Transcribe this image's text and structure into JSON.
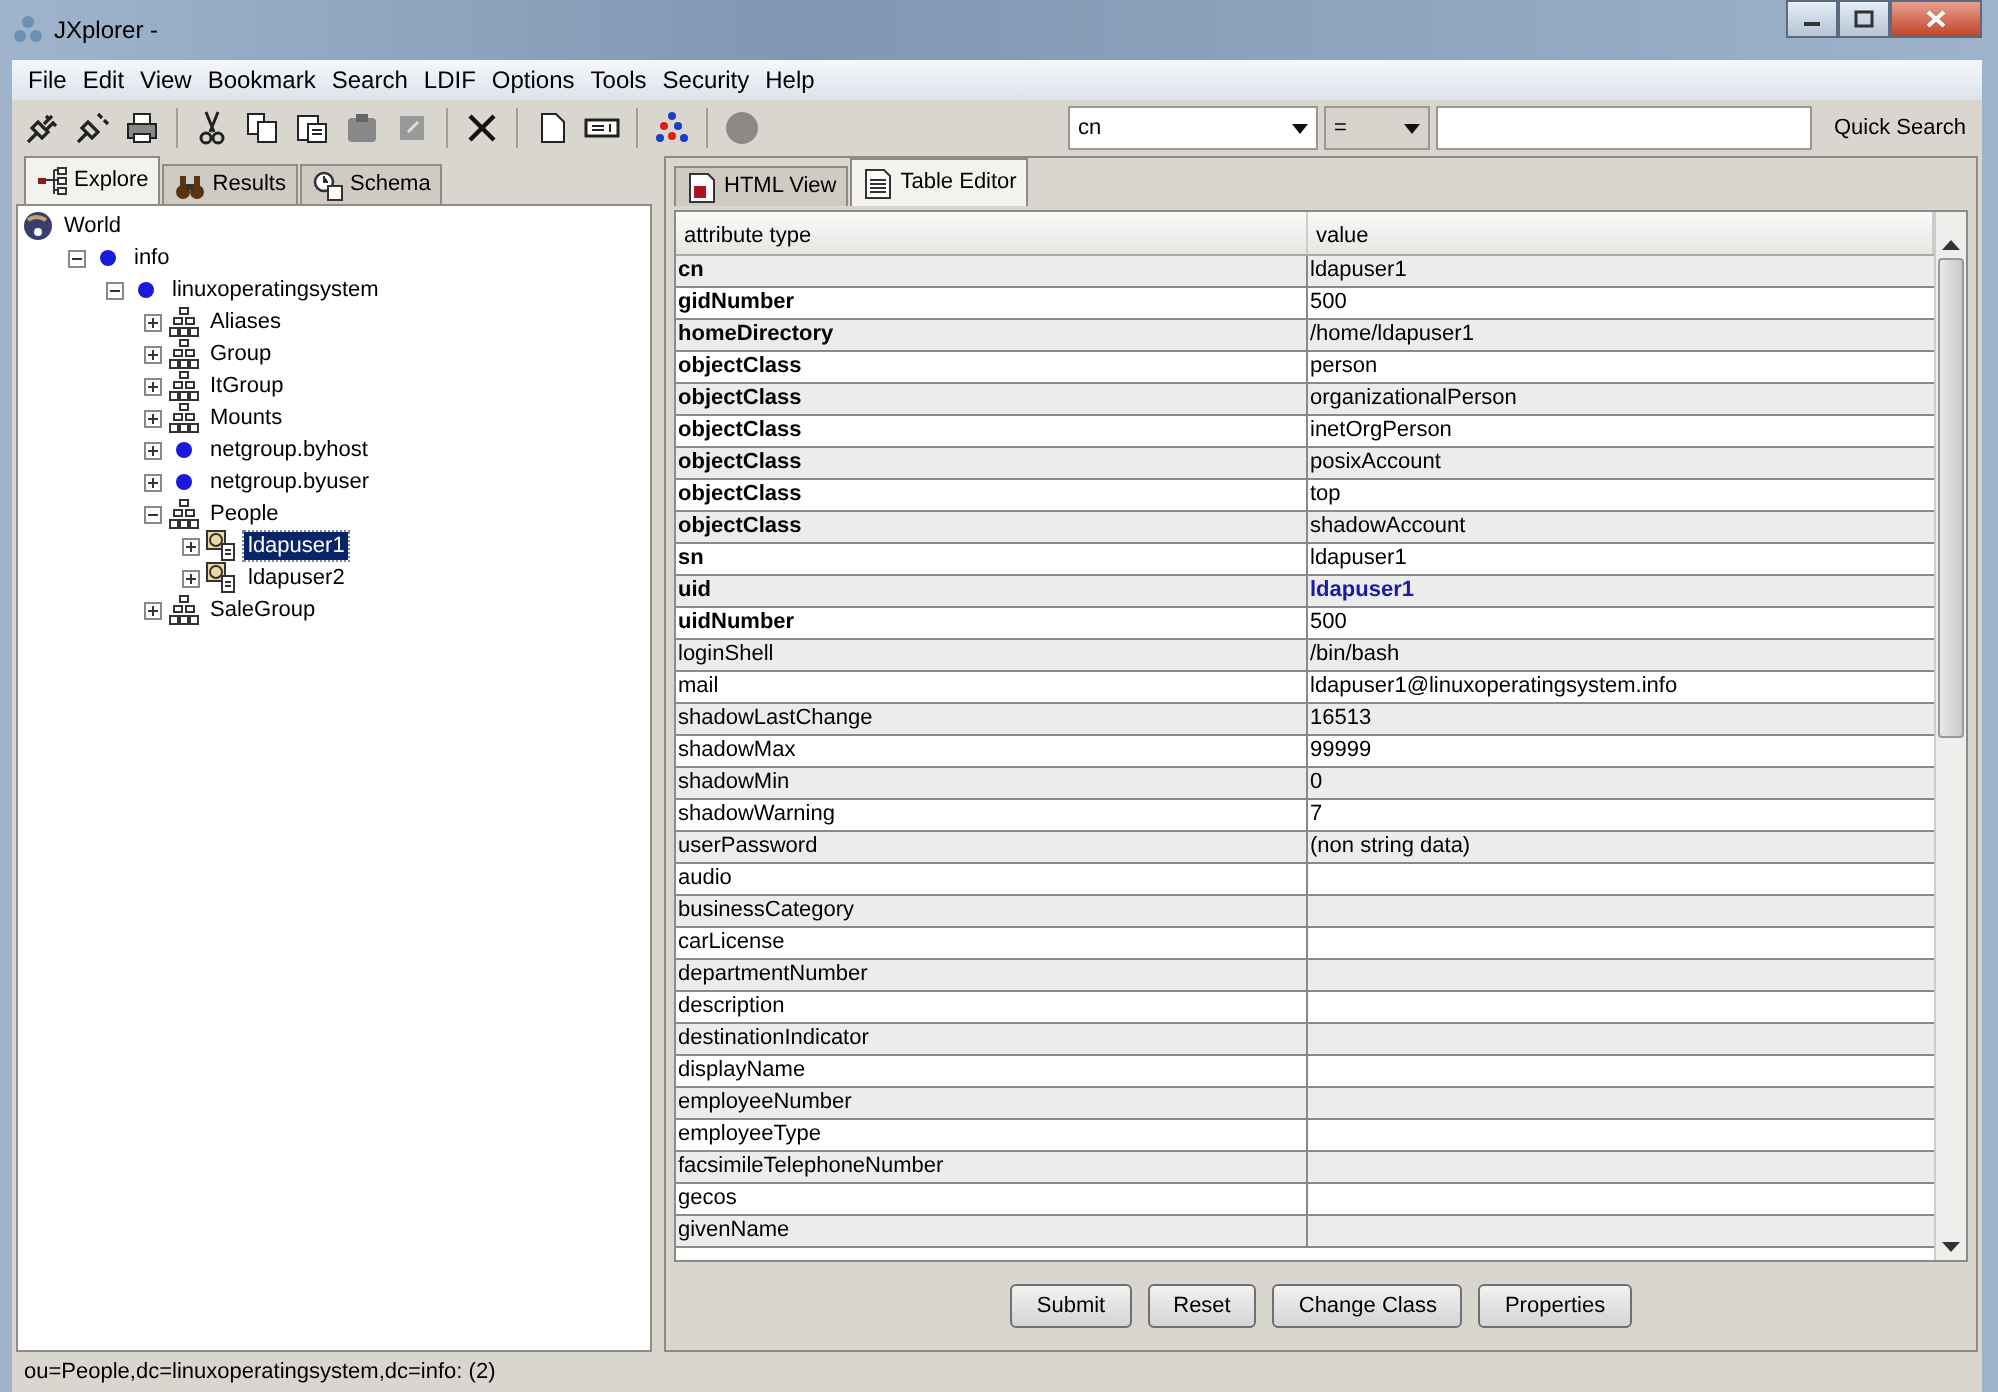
{
  "window": {
    "title": "JXplorer -"
  },
  "menu": [
    "File",
    "Edit",
    "View",
    "Bookmark",
    "Search",
    "LDIF",
    "Options",
    "Tools",
    "Security",
    "Help"
  ],
  "toolbar": {
    "search_attribute": "cn",
    "search_operator": "=",
    "quick_search": "Quick Search"
  },
  "left_tabs": [
    {
      "label": "Explore",
      "selected": true,
      "kind": "explore"
    },
    {
      "label": "Results",
      "selected": false,
      "kind": "results"
    },
    {
      "label": "Schema",
      "selected": false,
      "kind": "schema"
    }
  ],
  "tree": [
    {
      "label": "World",
      "kind": "world",
      "selected": false,
      "children": [
        {
          "label": "info",
          "kind": "dc",
          "expanded": true,
          "selected": false,
          "children": [
            {
              "label": "linuxoperatingsystem",
              "kind": "dc",
              "expanded": true,
              "selected": false,
              "children": [
                {
                  "label": "Aliases",
                  "kind": "ou",
                  "expanded": false,
                  "selected": false
                },
                {
                  "label": "Group",
                  "kind": "ou",
                  "expanded": false,
                  "selected": false
                },
                {
                  "label": "ItGroup",
                  "kind": "ou",
                  "expanded": false,
                  "selected": false
                },
                {
                  "label": "Mounts",
                  "kind": "ou",
                  "expanded": false,
                  "selected": false
                },
                {
                  "label": "netgroup.byhost",
                  "kind": "dc",
                  "expanded": false,
                  "selected": false
                },
                {
                  "label": "netgroup.byuser",
                  "kind": "dc",
                  "expanded": false,
                  "selected": false
                },
                {
                  "label": "People",
                  "kind": "ou",
                  "expanded": true,
                  "selected": false,
                  "children": [
                    {
                      "label": "ldapuser1",
                      "kind": "person",
                      "expanded": false,
                      "selected": true
                    },
                    {
                      "label": "ldapuser2",
                      "kind": "person",
                      "expanded": false,
                      "selected": false
                    }
                  ]
                },
                {
                  "label": "SaleGroup",
                  "kind": "ou",
                  "expanded": false,
                  "selected": false
                }
              ]
            }
          ]
        }
      ]
    }
  ],
  "right_tabs": [
    {
      "label": "HTML View",
      "selected": false,
      "kind": "html"
    },
    {
      "label": "Table Editor",
      "selected": true,
      "kind": "table"
    }
  ],
  "table": {
    "columns": [
      "attribute type",
      "value"
    ],
    "rows": [
      {
        "attribute": "cn",
        "value": "ldapuser1",
        "kind": "required"
      },
      {
        "attribute": "gidNumber",
        "value": "500",
        "kind": "required"
      },
      {
        "attribute": "homeDirectory",
        "value": "/home/ldapuser1",
        "kind": "required"
      },
      {
        "attribute": "objectClass",
        "value": "person",
        "kind": "required"
      },
      {
        "attribute": "objectClass",
        "value": "organizationalPerson",
        "kind": "required"
      },
      {
        "attribute": "objectClass",
        "value": "inetOrgPerson",
        "kind": "required"
      },
      {
        "attribute": "objectClass",
        "value": "posixAccount",
        "kind": "required"
      },
      {
        "attribute": "objectClass",
        "value": "top",
        "kind": "required"
      },
      {
        "attribute": "objectClass",
        "value": "shadowAccount",
        "kind": "required"
      },
      {
        "attribute": "sn",
        "value": "ldapuser1",
        "kind": "required"
      },
      {
        "attribute": "uid",
        "value": "ldapuser1",
        "kind": "naming"
      },
      {
        "attribute": "uidNumber",
        "value": "500",
        "kind": "required"
      },
      {
        "attribute": "loginShell",
        "value": "/bin/bash",
        "kind": "optional"
      },
      {
        "attribute": "mail",
        "value": "ldapuser1@linuxoperatingsystem.info",
        "kind": "optional"
      },
      {
        "attribute": "shadowLastChange",
        "value": "16513",
        "kind": "optional"
      },
      {
        "attribute": "shadowMax",
        "value": "99999",
        "kind": "optional"
      },
      {
        "attribute": "shadowMin",
        "value": "0",
        "kind": "optional"
      },
      {
        "attribute": "shadowWarning",
        "value": "7",
        "kind": "optional"
      },
      {
        "attribute": "userPassword",
        "value": "(non string data)",
        "kind": "optional"
      },
      {
        "attribute": "audio",
        "kind": "optional"
      },
      {
        "attribute": "businessCategory",
        "kind": "optional"
      },
      {
        "attribute": "carLicense",
        "kind": "optional"
      },
      {
        "attribute": "departmentNumber",
        "kind": "optional"
      },
      {
        "attribute": "description",
        "kind": "optional"
      },
      {
        "attribute": "destinationIndicator",
        "kind": "optional"
      },
      {
        "attribute": "displayName",
        "kind": "optional"
      },
      {
        "attribute": "employeeNumber",
        "kind": "optional"
      },
      {
        "attribute": "employeeType",
        "kind": "optional"
      },
      {
        "attribute": "facsimileTelephoneNumber",
        "kind": "optional"
      },
      {
        "attribute": "gecos",
        "kind": "optional"
      },
      {
        "attribute": "givenName",
        "kind": "optional"
      }
    ]
  },
  "buttons": [
    "Submit",
    "Reset",
    "Change Class",
    "Properties"
  ],
  "status_bar": "ou=People,dc=linuxoperatingsystem,dc=info: (2)"
}
